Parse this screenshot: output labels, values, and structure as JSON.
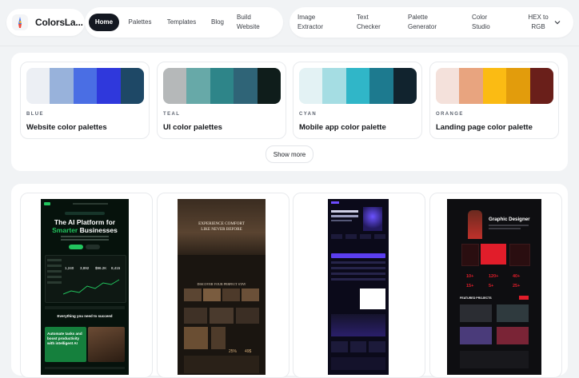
{
  "brand": {
    "name": "ColorsLa..."
  },
  "nav": {
    "home": "Home",
    "palettes": "Palettes",
    "templates": "Templates",
    "blog": "Blog",
    "build_website": [
      "Build",
      "Website"
    ],
    "image_extractor": [
      "Image",
      "Extractor"
    ],
    "text_checker": [
      "Text",
      "Checker"
    ],
    "palette_generator": [
      "Palette",
      "Generator"
    ],
    "color_studio": [
      "Color",
      "Studio"
    ],
    "hex_to_rgb": [
      "HEX to",
      "RGB"
    ]
  },
  "palettes": [
    {
      "category": "BLUE",
      "title": "Website color palettes",
      "colors": [
        "#eceff4",
        "#98b2db",
        "#4a6ee4",
        "#2f38dc",
        "#1e4866"
      ]
    },
    {
      "category": "TEAL",
      "title": "UI color palettes",
      "colors": [
        "#b5b8b9",
        "#67a9a8",
        "#2e8589",
        "#2f6477",
        "#0f1d1b"
      ]
    },
    {
      "category": "CYAN",
      "title": "Mobile app color palette",
      "colors": [
        "#e3f2f4",
        "#a5dde3",
        "#30b6c8",
        "#1d7a8f",
        "#11232e"
      ]
    },
    {
      "category": "ORANGE",
      "title": "Landing page color palette",
      "colors": [
        "#f4e1db",
        "#e8a47f",
        "#fbbb13",
        "#e29c0c",
        "#6a1f1a"
      ]
    }
  ],
  "show_more": "Show more",
  "templates": {
    "t1": {
      "headline1": "The AI Platform for",
      "headline2a": "Smarter",
      "headline2b": " Businesses",
      "section": "Everything you need to succeed",
      "cta1": "Automate tasks and",
      "cta2": "boost productivity",
      "cta3": "with intelligent AI",
      "stat1": "1,240",
      "stat2": "3,892",
      "stat3": "$96.2K",
      "stat4": "8,415",
      "accent": "#22c55e"
    },
    "t2": {
      "hero1": "EXPERIENCE COMFORT",
      "hero2": "LIKE NEVER BEFORE",
      "section": "DISCOVER YOUR PERFECT STAY",
      "price1": "25%",
      "price2": "49$"
    },
    "t3": {
      "accent": "#6d4cff"
    },
    "t4": {
      "headline": "Graphic Designer",
      "stat1": "10+",
      "stat2": "120+",
      "stat3": "40+",
      "stat4": "15+",
      "stat5": "5+",
      "stat6": "25+",
      "section": "FEATURED PROJECTS",
      "accent": "#e11d2a"
    }
  }
}
